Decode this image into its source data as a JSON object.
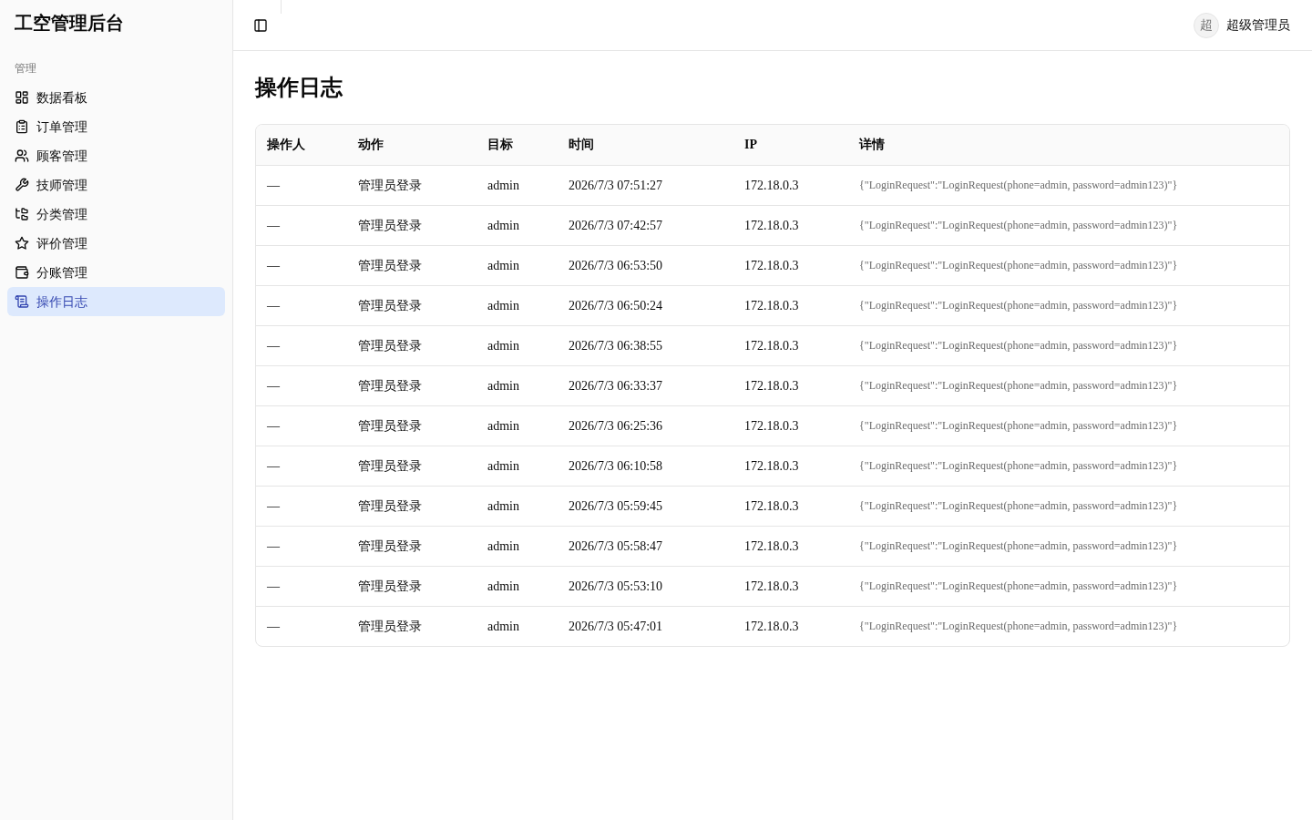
{
  "sidebar": {
    "title": "工空管理后台",
    "section_label": "管理",
    "items": [
      {
        "label": "数据看板",
        "selected": false
      },
      {
        "label": "订单管理",
        "selected": false
      },
      {
        "label": "顾客管理",
        "selected": false
      },
      {
        "label": "技师管理",
        "selected": false
      },
      {
        "label": "分类管理",
        "selected": false
      },
      {
        "label": "评价管理",
        "selected": false
      },
      {
        "label": "分账管理",
        "selected": false
      },
      {
        "label": "操作日志",
        "selected": true
      }
    ]
  },
  "header": {
    "avatar_text": "超",
    "user_name": "超级管理员"
  },
  "page": {
    "title": "操作日志"
  },
  "table": {
    "columns": [
      "操作人",
      "动作",
      "目标",
      "时间",
      "IP",
      "详情"
    ],
    "rows": [
      [
        "—",
        "管理员登录",
        "admin",
        "2026/7/3 07:51:27",
        "172.18.0.3",
        "{\"LoginRequest\":\"LoginRequest(phone=admin, password=admin123)\"}"
      ],
      [
        "—",
        "管理员登录",
        "admin",
        "2026/7/3 07:42:57",
        "172.18.0.3",
        "{\"LoginRequest\":\"LoginRequest(phone=admin, password=admin123)\"}"
      ],
      [
        "—",
        "管理员登录",
        "admin",
        "2026/7/3 06:53:50",
        "172.18.0.3",
        "{\"LoginRequest\":\"LoginRequest(phone=admin, password=admin123)\"}"
      ],
      [
        "—",
        "管理员登录",
        "admin",
        "2026/7/3 06:50:24",
        "172.18.0.3",
        "{\"LoginRequest\":\"LoginRequest(phone=admin, password=admin123)\"}"
      ],
      [
        "—",
        "管理员登录",
        "admin",
        "2026/7/3 06:38:55",
        "172.18.0.3",
        "{\"LoginRequest\":\"LoginRequest(phone=admin, password=admin123)\"}"
      ],
      [
        "—",
        "管理员登录",
        "admin",
        "2026/7/3 06:33:37",
        "172.18.0.3",
        "{\"LoginRequest\":\"LoginRequest(phone=admin, password=admin123)\"}"
      ],
      [
        "—",
        "管理员登录",
        "admin",
        "2026/7/3 06:25:36",
        "172.18.0.3",
        "{\"LoginRequest\":\"LoginRequest(phone=admin, password=admin123)\"}"
      ],
      [
        "—",
        "管理员登录",
        "admin",
        "2026/7/3 06:10:58",
        "172.18.0.3",
        "{\"LoginRequest\":\"LoginRequest(phone=admin, password=admin123)\"}"
      ],
      [
        "—",
        "管理员登录",
        "admin",
        "2026/7/3 05:59:45",
        "172.18.0.3",
        "{\"LoginRequest\":\"LoginRequest(phone=admin, password=admin123)\"}"
      ],
      [
        "—",
        "管理员登录",
        "admin",
        "2026/7/3 05:58:47",
        "172.18.0.3",
        "{\"LoginRequest\":\"LoginRequest(phone=admin, password=admin123)\"}"
      ],
      [
        "—",
        "管理员登录",
        "admin",
        "2026/7/3 05:53:10",
        "172.18.0.3",
        "{\"LoginRequest\":\"LoginRequest(phone=admin, password=admin123)\"}"
      ],
      [
        "—",
        "管理员登录",
        "admin",
        "2026/7/3 05:47:01",
        "172.18.0.3",
        "{\"LoginRequest\":\"LoginRequest(phone=admin, password=admin123)\"}"
      ]
    ]
  }
}
